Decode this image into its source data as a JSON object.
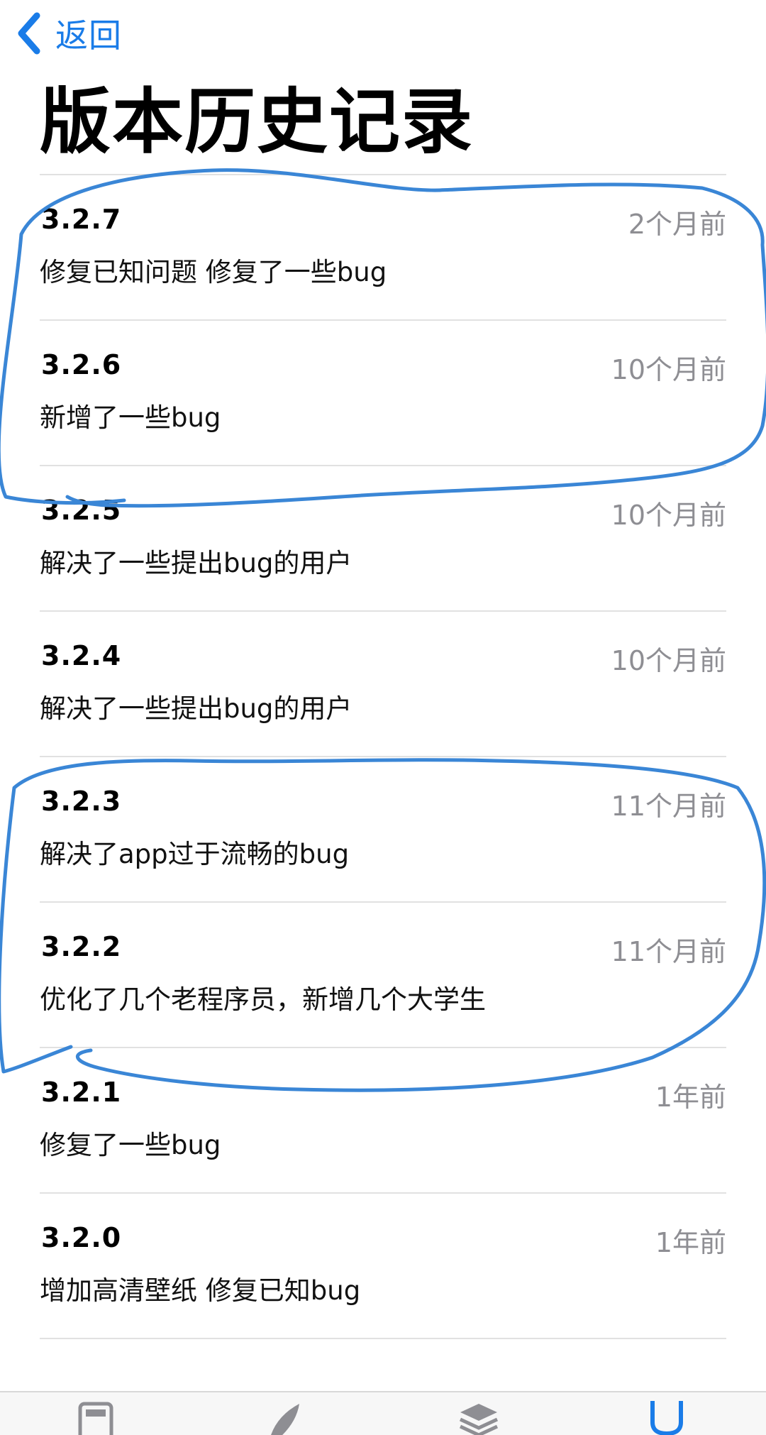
{
  "nav": {
    "back_label": "返回"
  },
  "page_title": "版本历史记录",
  "versions": [
    {
      "version": "3.2.7",
      "time": "2个月前",
      "notes": "修复已知问题 修复了一些bug"
    },
    {
      "version": "3.2.6",
      "time": "10个月前",
      "notes": "新增了一些bug"
    },
    {
      "version": "3.2.5",
      "time": "10个月前",
      "notes": "解决了一些提出bug的用户"
    },
    {
      "version": "3.2.4",
      "time": "10个月前",
      "notes": "解决了一些提出bug的用户"
    },
    {
      "version": "3.2.3",
      "time": "11个月前",
      "notes": "解决了app过于流畅的bug"
    },
    {
      "version": "3.2.2",
      "time": "11个月前",
      "notes": "优化了几个老程序员，新增几个大学生"
    },
    {
      "version": "3.2.1",
      "time": "1年前",
      "notes": "修复了一些bug"
    },
    {
      "version": "3.2.0",
      "time": "1年前",
      "notes": "增加高清壁纸 修复已知bug"
    }
  ],
  "tabbar": {
    "icons": [
      "today-icon",
      "games-icon",
      "apps-icon",
      "updates-icon"
    ]
  },
  "colors": {
    "link_blue": "#1a7ce8",
    "annotation_blue": "#3a86d6",
    "secondary_gray": "#8e8e93"
  }
}
